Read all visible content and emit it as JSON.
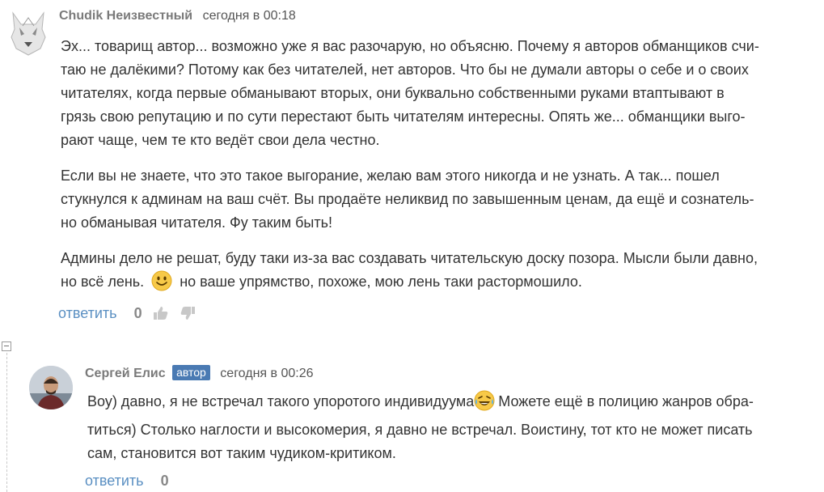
{
  "comments": [
    {
      "author": "Chudik Неизвестный",
      "time": "сегодня в 00:18",
      "paragraphs": [
        [
          "Эх... товарищ автор... возможно уже я вас разочарую, но объясню. Почему я авторов обманщиков счи-",
          "таю не далёкими? Потому как без читателей, нет авторов. Что бы не думали авторы о себе и о своих",
          "читателях, когда первые обманывают вторых, они буквально собственными руками втаптывают в",
          "грязь свою репутацию и по сути перестают быть читателям интересны. Опять же... обманщики выго-",
          "рают чаще, чем те кто ведёт свои дела честно."
        ],
        [
          "Если вы не знаете, что это такое выгорание, желаю вам этого никогда и не узнать. А так... пошел",
          "стукнулся к админам на ваш счёт. Вы продаёте неликвид по завышенным ценам, да ещё и сознатель-",
          "но обманывая читателя. Фу таким быть!"
        ]
      ],
      "last_line_1": "Админы дело не решат, буду таки из-за вас создавать читательскую доску позора. Мысли были давно,",
      "last_line_2a": "но всё лень.",
      "last_line_2b": "но ваше упрямство, похоже, мою лень таки растормошило.",
      "reply_label": "ответить",
      "score": "0",
      "icons": {
        "emoji": "smile-emoji-icon",
        "up": "thumbs-up-icon",
        "down": "thumbs-down-icon"
      }
    },
    {
      "author": "Сергей Елис",
      "badge": "автор",
      "time": "сегодня в 00:26",
      "line_1a": "Воу) давно, я не встречал такого упоротого индивидуума",
      "line_1b": "Можете ещё в полицию жанров обра-",
      "line_2": "титься) Столько наглости и высокомерия, я давно не встречал. Воистину, тот кто не может писать",
      "line_3": "сам, становится вот таким чудиком-критиком.",
      "reply_label": "ответить",
      "score": "0",
      "icons": {
        "emoji": "laughing-tears-emoji-icon"
      }
    }
  ],
  "colors": {
    "accent": "#5a8fc2",
    "badge": "#4a7ab3",
    "author": "#7a7a7a"
  }
}
